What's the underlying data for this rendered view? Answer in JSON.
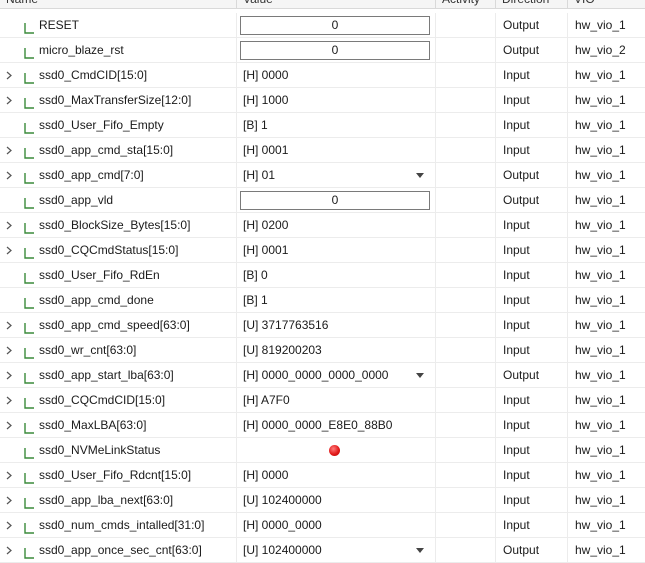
{
  "columns": {
    "name": "Name",
    "value": "Value",
    "activity": "Activity",
    "direction": "Direction",
    "vio": "VIO"
  },
  "colors": {
    "led_off": "#e21b1b",
    "signal_icon": "#3a8a3a"
  },
  "rows": [
    {
      "name": "RESET",
      "value": "0",
      "kind": "box",
      "expandable": false,
      "direction": "Output",
      "vio": "hw_vio_1"
    },
    {
      "name": "micro_blaze_rst",
      "value": "0",
      "kind": "box",
      "expandable": false,
      "direction": "Output",
      "vio": "hw_vio_2"
    },
    {
      "name": "ssd0_CmdCID[15:0]",
      "value": "[H] 0000",
      "kind": "text",
      "expandable": true,
      "direction": "Input",
      "vio": "hw_vio_1"
    },
    {
      "name": "ssd0_MaxTransferSize[12:0]",
      "value": "[H] 1000",
      "kind": "text",
      "expandable": true,
      "direction": "Input",
      "vio": "hw_vio_1"
    },
    {
      "name": "ssd0_User_Fifo_Empty",
      "value": "[B] 1",
      "kind": "text",
      "expandable": false,
      "direction": "Input",
      "vio": "hw_vio_1"
    },
    {
      "name": "ssd0_app_cmd_sta[15:0]",
      "value": "[H] 0001",
      "kind": "text",
      "expandable": true,
      "direction": "Input",
      "vio": "hw_vio_1"
    },
    {
      "name": "ssd0_app_cmd[7:0]",
      "value": "[H] 01",
      "kind": "dropdown",
      "expandable": true,
      "direction": "Output",
      "vio": "hw_vio_1"
    },
    {
      "name": "ssd0_app_vld",
      "value": "0",
      "kind": "box",
      "expandable": false,
      "direction": "Output",
      "vio": "hw_vio_1"
    },
    {
      "name": "ssd0_BlockSize_Bytes[15:0]",
      "value": "[H] 0200",
      "kind": "text",
      "expandable": true,
      "direction": "Input",
      "vio": "hw_vio_1"
    },
    {
      "name": "ssd0_CQCmdStatus[15:0]",
      "value": "[H] 0001",
      "kind": "text",
      "expandable": true,
      "direction": "Input",
      "vio": "hw_vio_1"
    },
    {
      "name": "ssd0_User_Fifo_RdEn",
      "value": "[B] 0",
      "kind": "text",
      "expandable": false,
      "direction": "Input",
      "vio": "hw_vio_1"
    },
    {
      "name": "ssd0_app_cmd_done",
      "value": "[B] 1",
      "kind": "text",
      "expandable": false,
      "direction": "Input",
      "vio": "hw_vio_1"
    },
    {
      "name": "ssd0_app_cmd_speed[63:0]",
      "value": "[U] 3717763516",
      "kind": "text",
      "expandable": true,
      "direction": "Input",
      "vio": "hw_vio_1"
    },
    {
      "name": "ssd0_wr_cnt[63:0]",
      "value": "[U] 819200203",
      "kind": "text",
      "expandable": true,
      "direction": "Input",
      "vio": "hw_vio_1"
    },
    {
      "name": "ssd0_app_start_lba[63:0]",
      "value": "[H] 0000_0000_0000_0000",
      "kind": "dropdown",
      "expandable": true,
      "direction": "Output",
      "vio": "hw_vio_1"
    },
    {
      "name": "ssd0_CQCmdCID[15:0]",
      "value": "[H] A7F0",
      "kind": "text",
      "expandable": true,
      "direction": "Input",
      "vio": "hw_vio_1"
    },
    {
      "name": "ssd0_MaxLBA[63:0]",
      "value": "[H] 0000_0000_E8E0_88B0",
      "kind": "text",
      "expandable": true,
      "direction": "Input",
      "vio": "hw_vio_1"
    },
    {
      "name": "ssd0_NVMeLinkStatus",
      "value": "",
      "kind": "led",
      "expandable": false,
      "direction": "Input",
      "vio": "hw_vio_1"
    },
    {
      "name": "ssd0_User_Fifo_Rdcnt[15:0]",
      "value": "[H] 0000",
      "kind": "text",
      "expandable": true,
      "direction": "Input",
      "vio": "hw_vio_1"
    },
    {
      "name": "ssd0_app_lba_next[63:0]",
      "value": "[U] 102400000",
      "kind": "text",
      "expandable": true,
      "direction": "Input",
      "vio": "hw_vio_1"
    },
    {
      "name": "ssd0_num_cmds_intalled[31:0]",
      "value": "[H] 0000_0000",
      "kind": "text",
      "expandable": true,
      "direction": "Input",
      "vio": "hw_vio_1"
    },
    {
      "name": "ssd0_app_once_sec_cnt[63:0]",
      "value": "[U] 102400000",
      "kind": "dropdown",
      "expandable": true,
      "direction": "Output",
      "vio": "hw_vio_1"
    }
  ]
}
